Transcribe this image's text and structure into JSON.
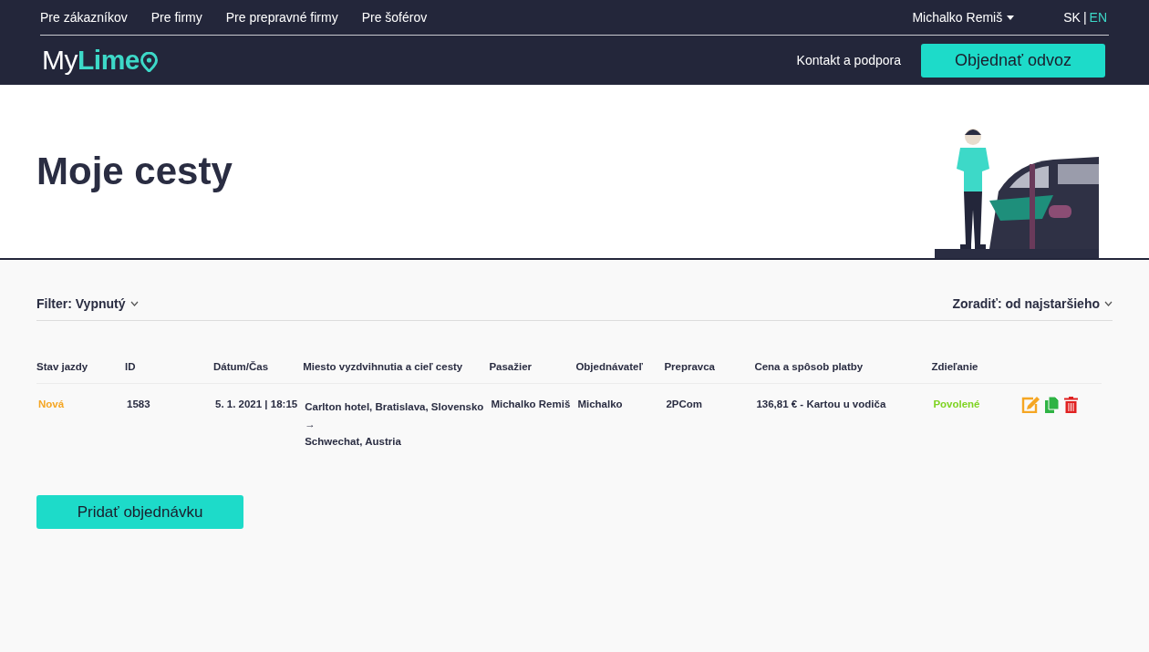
{
  "top_nav": {
    "links": [
      "Pre zákazníkov",
      "Pre firmy",
      "Pre prepravné firmy",
      "Pre šoférov"
    ],
    "user": "Michalko Remiš",
    "language_separator": "|",
    "languages": [
      {
        "label": "SK",
        "selected": false
      },
      {
        "label": "EN",
        "selected": true
      }
    ]
  },
  "header": {
    "logo": {
      "part_1": "My",
      "part_2": "Lime"
    },
    "support_link": "Kontakt a podpora",
    "order_button": "Objednať odvoz"
  },
  "page_title": "Moje cesty",
  "filter": {
    "label": "Filter: Vypnutý"
  },
  "sort": {
    "label": "Zoradiť: od najstaršieho"
  },
  "table": {
    "columns": [
      "Stav jazdy",
      "ID",
      "Dátum/Čas",
      "Miesto vyzdvihnutia a cieľ cesty",
      "Pasažier",
      "Objednávateľ",
      "Prepravca",
      "Cena a spôsob platby",
      "Zdieľanie"
    ],
    "rows": [
      {
        "status": {
          "text": "Nová",
          "color": "#f5a623"
        },
        "id": "1583",
        "datetime": "5. 1. 2021 | 18:15",
        "pickup": "Carlton hotel, Bratislava, Slovensko",
        "arrow": "→",
        "destination": "Schwechat, Austria",
        "passenger": "Michalko Remiš",
        "orderer": "Michalko",
        "carrier": "2PCom",
        "price": "136,81 € - Kartou u vodiča",
        "sharing": {
          "text": "Povolené",
          "color": "#7ed321"
        }
      }
    ]
  },
  "add_button": "Pridať objednávku"
}
